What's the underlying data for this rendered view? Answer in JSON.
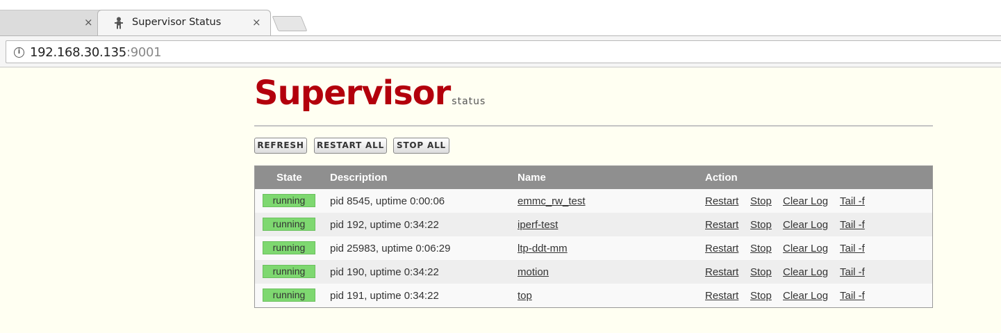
{
  "browser": {
    "tabs": [
      {
        "title": "",
        "active": false
      },
      {
        "title": "Supervisor Status",
        "active": true
      }
    ],
    "close_glyph": "×",
    "url_host": "192.168.30.135",
    "url_port": ":9001",
    "info_glyph": "i"
  },
  "header": {
    "logo_main": "Supervisor",
    "logo_sub": "status"
  },
  "actions": {
    "refresh": "REFRESH",
    "restart_all": "RESTART ALL",
    "stop_all": "STOP ALL"
  },
  "table": {
    "headers": {
      "state": "State",
      "description": "Description",
      "name": "Name",
      "action": "Action"
    },
    "rows": [
      {
        "state": "running",
        "description": "pid 8545, uptime 0:00:06",
        "name": "emmc_rw_test",
        "actions": [
          "Restart",
          "Stop",
          "Clear Log",
          "Tail -f"
        ]
      },
      {
        "state": "running",
        "description": "pid 192, uptime 0:34:22",
        "name": "iperf-test",
        "actions": [
          "Restart",
          "Stop",
          "Clear Log",
          "Tail -f"
        ]
      },
      {
        "state": "running",
        "description": "pid 25983, uptime 0:06:29",
        "name": "ltp-ddt-mm",
        "actions": [
          "Restart",
          "Stop",
          "Clear Log",
          "Tail -f"
        ]
      },
      {
        "state": "running",
        "description": "pid 190, uptime 0:34:22",
        "name": "motion",
        "actions": [
          "Restart",
          "Stop",
          "Clear Log",
          "Tail -f"
        ]
      },
      {
        "state": "running",
        "description": "pid 191, uptime 0:34:22",
        "name": "top",
        "actions": [
          "Restart",
          "Stop",
          "Clear Log",
          "Tail -f"
        ]
      }
    ]
  },
  "colors": {
    "page_bg": "#fffff2",
    "logo_red": "#b3000c",
    "header_bg": "#8f8f8f",
    "running_green": "#7ed870"
  }
}
